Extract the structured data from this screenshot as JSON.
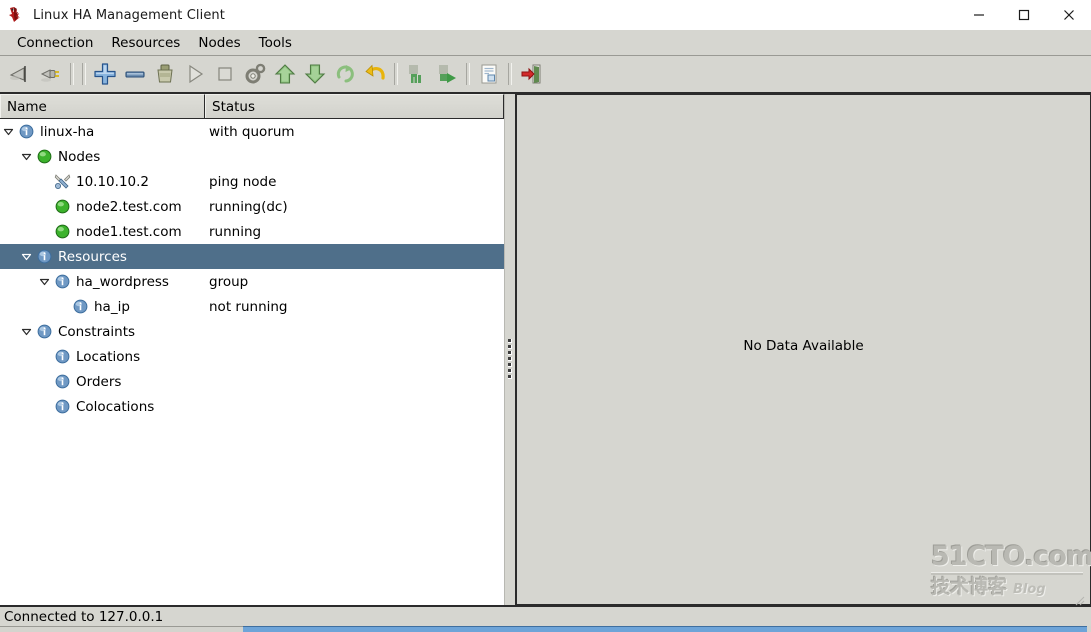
{
  "window": {
    "title": "Linux HA Management Client",
    "app_icon": "linux-ha-logo-icon",
    "controls": {
      "minimize": "minimize-icon",
      "maximize": "maximize-icon",
      "close": "close-icon"
    }
  },
  "menubar": {
    "items": [
      {
        "label": "Connection"
      },
      {
        "label": "Resources"
      },
      {
        "label": "Nodes"
      },
      {
        "label": "Tools"
      }
    ]
  },
  "toolbar": {
    "items": [
      {
        "name": "connect-icon",
        "type": "button"
      },
      {
        "name": "disconnect-icon",
        "type": "button"
      },
      {
        "name": "separator-1",
        "type": "separator"
      },
      {
        "name": "add-icon",
        "type": "button"
      },
      {
        "name": "remove-icon",
        "type": "button"
      },
      {
        "name": "cleanup-icon",
        "type": "button"
      },
      {
        "name": "start-icon",
        "type": "button"
      },
      {
        "name": "stop-icon",
        "type": "button"
      },
      {
        "name": "manage-icon",
        "type": "button"
      },
      {
        "name": "migrate-up-icon",
        "type": "button"
      },
      {
        "name": "migrate-down-icon",
        "type": "button"
      },
      {
        "name": "refresh-icon",
        "type": "button"
      },
      {
        "name": "undo-icon",
        "type": "button"
      },
      {
        "name": "separator-2",
        "type": "separator"
      },
      {
        "name": "standby-icon",
        "type": "button"
      },
      {
        "name": "activate-icon",
        "type": "button"
      },
      {
        "name": "separator-3",
        "type": "separator"
      },
      {
        "name": "document-icon",
        "type": "button"
      },
      {
        "name": "separator-4",
        "type": "separator"
      },
      {
        "name": "exit-icon",
        "type": "button"
      }
    ]
  },
  "tree": {
    "columns": [
      {
        "key": "name",
        "label": "Name"
      },
      {
        "key": "status",
        "label": "Status"
      }
    ],
    "rows": [
      {
        "label": "linux-ha",
        "status": "with quorum",
        "depth": 0,
        "icon": "info-icon",
        "twisty": "expanded",
        "selected": false
      },
      {
        "label": "Nodes",
        "status": "",
        "depth": 1,
        "icon": "green-ball-icon",
        "twisty": "expanded",
        "selected": false
      },
      {
        "label": "10.10.10.2",
        "status": "ping node",
        "depth": 2,
        "icon": "tools-icon",
        "twisty": "none",
        "selected": false
      },
      {
        "label": "node2.test.com",
        "status": "running(dc)",
        "depth": 2,
        "icon": "green-ball-icon",
        "twisty": "none",
        "selected": false
      },
      {
        "label": "node1.test.com",
        "status": "running",
        "depth": 2,
        "icon": "green-ball-icon",
        "twisty": "none",
        "selected": false
      },
      {
        "label": "Resources",
        "status": "",
        "depth": 1,
        "icon": "info-icon",
        "twisty": "expanded",
        "selected": true
      },
      {
        "label": "ha_wordpress",
        "status": "group",
        "depth": 2,
        "icon": "info-icon",
        "twisty": "expanded",
        "selected": false
      },
      {
        "label": "ha_ip",
        "status": "not running",
        "depth": 3,
        "icon": "info-icon",
        "twisty": "none",
        "selected": false
      },
      {
        "label": "Constraints",
        "status": "",
        "depth": 1,
        "icon": "info-icon",
        "twisty": "expanded",
        "selected": false
      },
      {
        "label": "Locations",
        "status": "",
        "depth": 2,
        "icon": "info-icon",
        "twisty": "none",
        "selected": false
      },
      {
        "label": "Orders",
        "status": "",
        "depth": 2,
        "icon": "info-icon",
        "twisty": "none",
        "selected": false
      },
      {
        "label": "Colocations",
        "status": "",
        "depth": 2,
        "icon": "info-icon",
        "twisty": "none",
        "selected": false
      }
    ]
  },
  "detail_pane": {
    "empty_message": "No Data Available"
  },
  "watermark": {
    "line1": "51CTO.com",
    "line2": "技术博客",
    "line3": "Blog"
  },
  "statusbar": {
    "message": "Connected to 127.0.0.1"
  },
  "colors": {
    "selection": "#4f6f8a",
    "chrome": "#d6d6d0",
    "pane_background": "#ffffff",
    "node_green": "#3fbb2f",
    "info_blue": "#6f9cc8",
    "taskbar_blue": "#6ea4d8"
  }
}
